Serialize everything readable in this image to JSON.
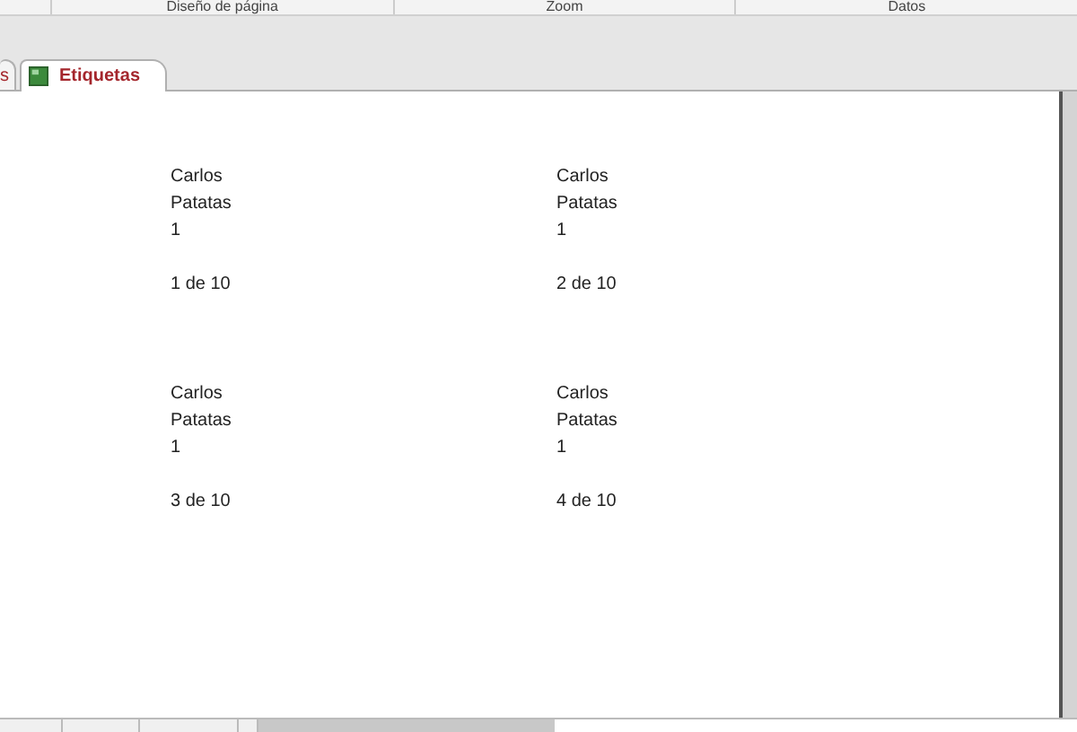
{
  "ribbon_groups": [
    "Diseño de página",
    "Zoom",
    "Datos"
  ],
  "tabs": [
    {
      "label": "s",
      "selected": false
    },
    {
      "label": "Etiquetas",
      "selected": true
    }
  ],
  "labels": [
    {
      "lines": [
        "Carlos",
        "Patatas",
        "1"
      ],
      "page": "1 de 10"
    },
    {
      "lines": [
        "Carlos",
        "Patatas",
        "1"
      ],
      "page": "2 de 10"
    },
    {
      "lines": [
        "Carlos",
        "Patatas",
        "1"
      ],
      "page": "3 de 10"
    },
    {
      "lines": [
        "Carlos",
        "Patatas",
        "1"
      ],
      "page": "4 de 10"
    }
  ]
}
